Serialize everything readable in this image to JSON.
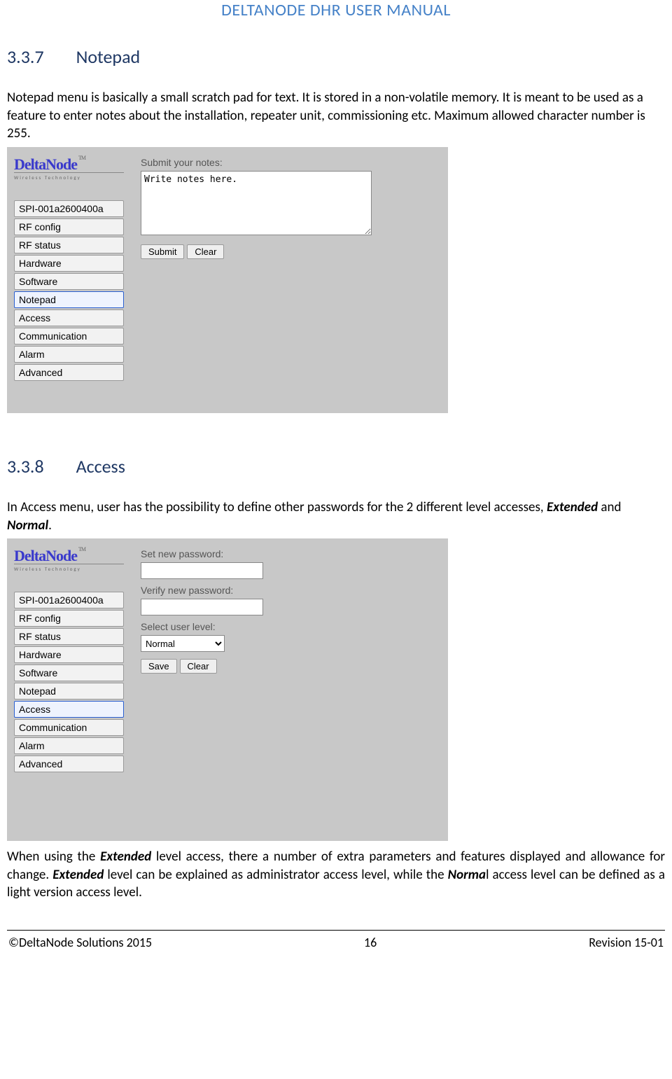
{
  "doc_header": "DELTANODE DHR USER MANUAL",
  "sections": {
    "s1": {
      "num": "3.3.7",
      "title": "Notepad",
      "para": "Notepad menu is basically a small scratch pad for text. It is stored in a non-volatile memory. It is meant to be used as a feature to enter notes about the installation, repeater unit, commissioning etc. Maximum allowed character number is 255."
    },
    "s2": {
      "num": "3.3.8",
      "title": "Access",
      "para_prefix": "In Access menu, user has the possibility to define other passwords for the 2 different level accesses, ",
      "bold1": "Extended",
      "mid1": " and ",
      "bold2": "Normal",
      "suffix1": ".",
      "para2_a": "When using the ",
      "para2_b": "Extended",
      "para2_c": " level access, there a number of extra parameters and features displayed and allowance for change. ",
      "para2_d": "Extended",
      "para2_e": " level can be explained as administrator access level, while the ",
      "para2_f": "Norma",
      "para2_g": "l access level can be defined as a light version access level."
    }
  },
  "logo": {
    "main": "DeltaNode",
    "tm": "TM",
    "sub": "Wireless  Technology"
  },
  "menu_items": [
    "SPI-001a2600400a",
    "RF config",
    "RF status",
    "Hardware",
    "Software",
    "Notepad",
    "Access",
    "Communication",
    "Alarm",
    "Advanced"
  ],
  "notepad_ui": {
    "label": "Submit your notes:",
    "textarea_value": "Write notes here.",
    "submit": "Submit",
    "clear": "Clear",
    "selected_index": 5
  },
  "access_ui": {
    "label1": "Set new password:",
    "label2": "Verify new password:",
    "label3": "Select user level:",
    "select_value": "Normal",
    "save": "Save",
    "clear": "Clear",
    "selected_index": 6
  },
  "footer": {
    "left": "©DeltaNode Solutions 2015",
    "center": "16",
    "right": "Revision 15-01"
  }
}
